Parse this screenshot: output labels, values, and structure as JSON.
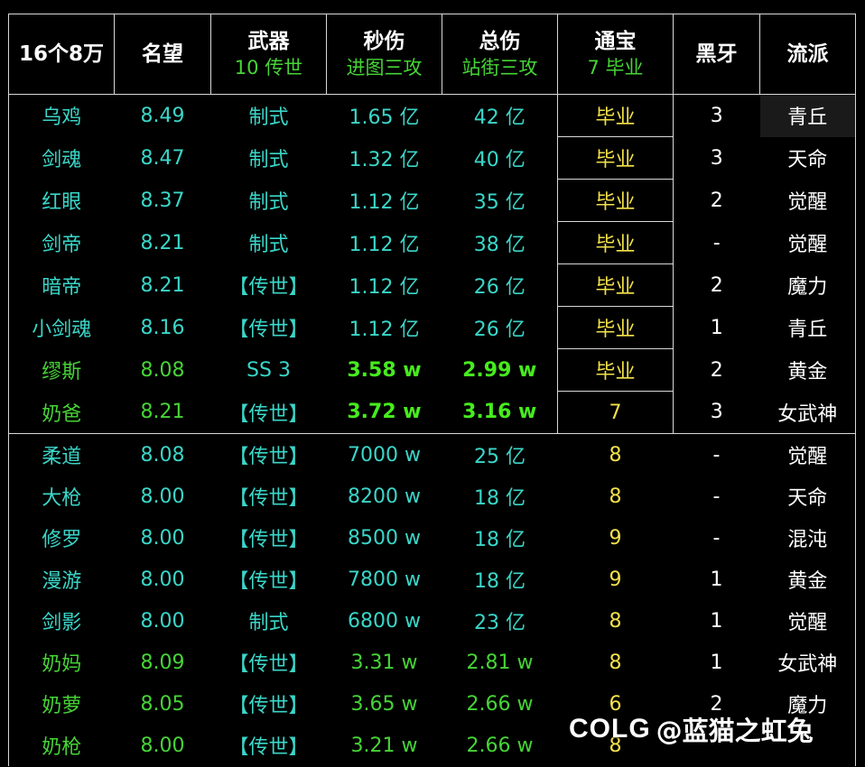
{
  "headers": [
    {
      "title": "16个8万",
      "sub": ""
    },
    {
      "title": "名望",
      "sub": ""
    },
    {
      "title": "武器",
      "sub": "10 传世"
    },
    {
      "title": "秒伤",
      "sub": "进图三攻"
    },
    {
      "title": "总伤",
      "sub": "站街三攻"
    },
    {
      "title": "通宝",
      "sub": "7 毕业"
    },
    {
      "title": "黑牙",
      "sub": ""
    },
    {
      "title": "流派",
      "sub": ""
    }
  ],
  "rows": [
    {
      "job": "乌鸡",
      "fame": "8.49",
      "weapon": "制式",
      "dps": "1.65 亿",
      "total": "42 亿",
      "tongbao": "毕业",
      "heiya": "3",
      "faction": "青丘"
    },
    {
      "job": "剑魂",
      "fame": "8.47",
      "weapon": "制式",
      "dps": "1.32 亿",
      "total": "40 亿",
      "tongbao": "毕业",
      "heiya": "3",
      "faction": "天命"
    },
    {
      "job": "红眼",
      "fame": "8.37",
      "weapon": "制式",
      "dps": "1.12 亿",
      "total": "35 亿",
      "tongbao": "毕业",
      "heiya": "2",
      "faction": "觉醒"
    },
    {
      "job": "剑帝",
      "fame": "8.21",
      "weapon": "制式",
      "dps": "1.12 亿",
      "total": "38 亿",
      "tongbao": "毕业",
      "heiya": "-",
      "faction": "觉醒"
    },
    {
      "job": "暗帝",
      "fame": "8.21",
      "weapon": "【传世】",
      "dps": "1.12 亿",
      "total": "26 亿",
      "tongbao": "毕业",
      "heiya": "2",
      "faction": "魔力"
    },
    {
      "job": "小剑魂",
      "fame": "8.16",
      "weapon": "【传世】",
      "dps": "1.12 亿",
      "total": "26 亿",
      "tongbao": "毕业",
      "heiya": "1",
      "faction": "青丘"
    },
    {
      "job": "缪斯",
      "fame": "8.08",
      "weapon": "SS 3",
      "dps": "3.58 w",
      "total": "2.99 w",
      "tongbao": "毕业",
      "heiya": "2",
      "faction": "黄金"
    },
    {
      "job": "奶爸",
      "fame": "8.21",
      "weapon": "【传世】",
      "dps": "3.72 w",
      "total": "3.16 w",
      "tongbao": "7",
      "heiya": "3",
      "faction": "女武神"
    },
    {
      "job": "柔道",
      "fame": "8.08",
      "weapon": "【传世】",
      "dps": "7000 w",
      "total": "25 亿",
      "tongbao": "8",
      "heiya": "-",
      "faction": "觉醒"
    },
    {
      "job": "大枪",
      "fame": "8.00",
      "weapon": "【传世】",
      "dps": "8200 w",
      "total": "18 亿",
      "tongbao": "8",
      "heiya": "-",
      "faction": "天命"
    },
    {
      "job": "修罗",
      "fame": "8.00",
      "weapon": "【传世】",
      "dps": "8500 w",
      "total": "18 亿",
      "tongbao": "9",
      "heiya": "-",
      "faction": "混沌"
    },
    {
      "job": "漫游",
      "fame": "8.00",
      "weapon": "【传世】",
      "dps": "7800 w",
      "total": "18 亿",
      "tongbao": "9",
      "heiya": "1",
      "faction": "黄金"
    },
    {
      "job": "剑影",
      "fame": "8.00",
      "weapon": "制式",
      "dps": "6800 w",
      "total": "23 亿",
      "tongbao": "8",
      "heiya": "1",
      "faction": "觉醒"
    },
    {
      "job": "奶妈",
      "fame": "8.09",
      "weapon": "【传世】",
      "dps": "3.31 w",
      "total": "2.81 w",
      "tongbao": "8",
      "heiya": "1",
      "faction": "女武神"
    },
    {
      "job": "奶萝",
      "fame": "8.05",
      "weapon": "【传世】",
      "dps": "3.65 w",
      "total": "2.66 w",
      "tongbao": "6",
      "heiya": "2",
      "faction": "魔力"
    },
    {
      "job": "奶枪",
      "fame": "8.00",
      "weapon": "【传世】",
      "dps": "3.21 w",
      "total": "2.66 w",
      "tongbao": "8",
      "heiya": "",
      "faction": ""
    }
  ],
  "watermark": {
    "logo": "COLG",
    "text": "@蓝猫之虹兔"
  },
  "colors": {
    "background": "#000000",
    "cyan_text": "#3ad6c8",
    "green_text": "#46d436",
    "yellow_text": "#f2e14a",
    "header_text": "#ffffff",
    "border": "#d8d8d8"
  }
}
